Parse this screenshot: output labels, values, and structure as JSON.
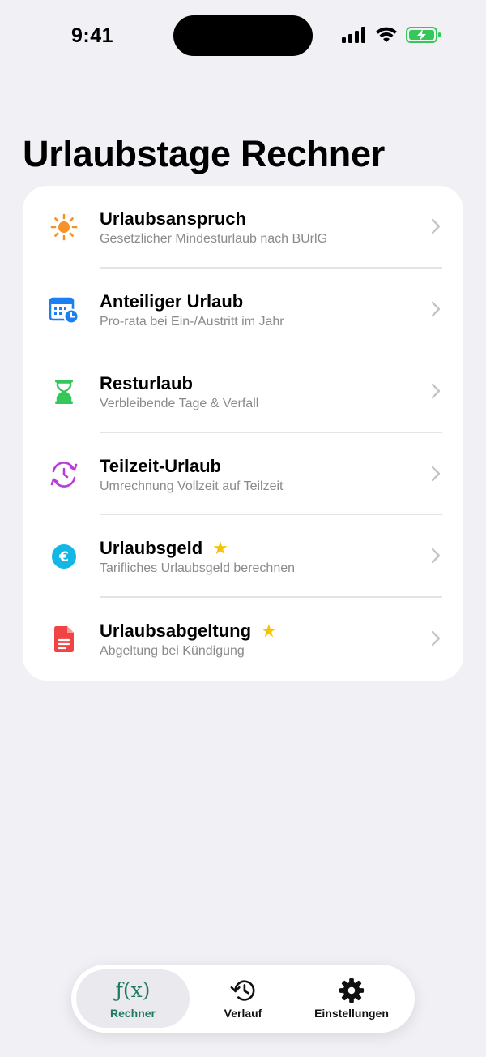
{
  "status_bar": {
    "time": "9:41"
  },
  "page": {
    "title": "Urlaubstage Rechner"
  },
  "menu": {
    "items": [
      {
        "title": "Urlaubsanspruch",
        "subtitle": "Gesetzlicher Mindesturlaub nach BUrlG",
        "icon": "sun-icon",
        "icon_color": "#f5922a",
        "premium": false
      },
      {
        "title": "Anteiliger Urlaub",
        "subtitle": "Pro-rata bei Ein-/Austritt im Jahr",
        "icon": "calendar-clock-icon",
        "icon_color": "#1a7ff0",
        "premium": false
      },
      {
        "title": "Resturlaub",
        "subtitle": "Verbleibende Tage & Verfall",
        "icon": "hourglass-icon",
        "icon_color": "#34c759",
        "premium": false
      },
      {
        "title": "Teilzeit-Urlaub",
        "subtitle": "Umrechnung Vollzeit auf Teilzeit",
        "icon": "clock-cycle-icon",
        "icon_color": "#b63fd6",
        "premium": false
      },
      {
        "title": "Urlaubsgeld",
        "subtitle": "Tarifliches Urlaubsgeld berechnen",
        "icon": "euro-icon",
        "icon_color": "#12b7e6",
        "premium": true
      },
      {
        "title": "Urlaubsabgeltung",
        "subtitle": "Abgeltung bei Kündigung",
        "icon": "document-icon",
        "icon_color": "#f04444",
        "premium": true
      }
    ],
    "premium_star": "★",
    "star_color": "#f5c400"
  },
  "tab_bar": {
    "tabs": [
      {
        "label": "Rechner",
        "icon": "function-icon",
        "glyph": "ƒ(x)",
        "active": true
      },
      {
        "label": "Verlauf",
        "icon": "history-icon",
        "active": false
      },
      {
        "label": "Einstellungen",
        "icon": "gear-icon",
        "active": false
      }
    ],
    "accent_color": "#1f7a64"
  }
}
